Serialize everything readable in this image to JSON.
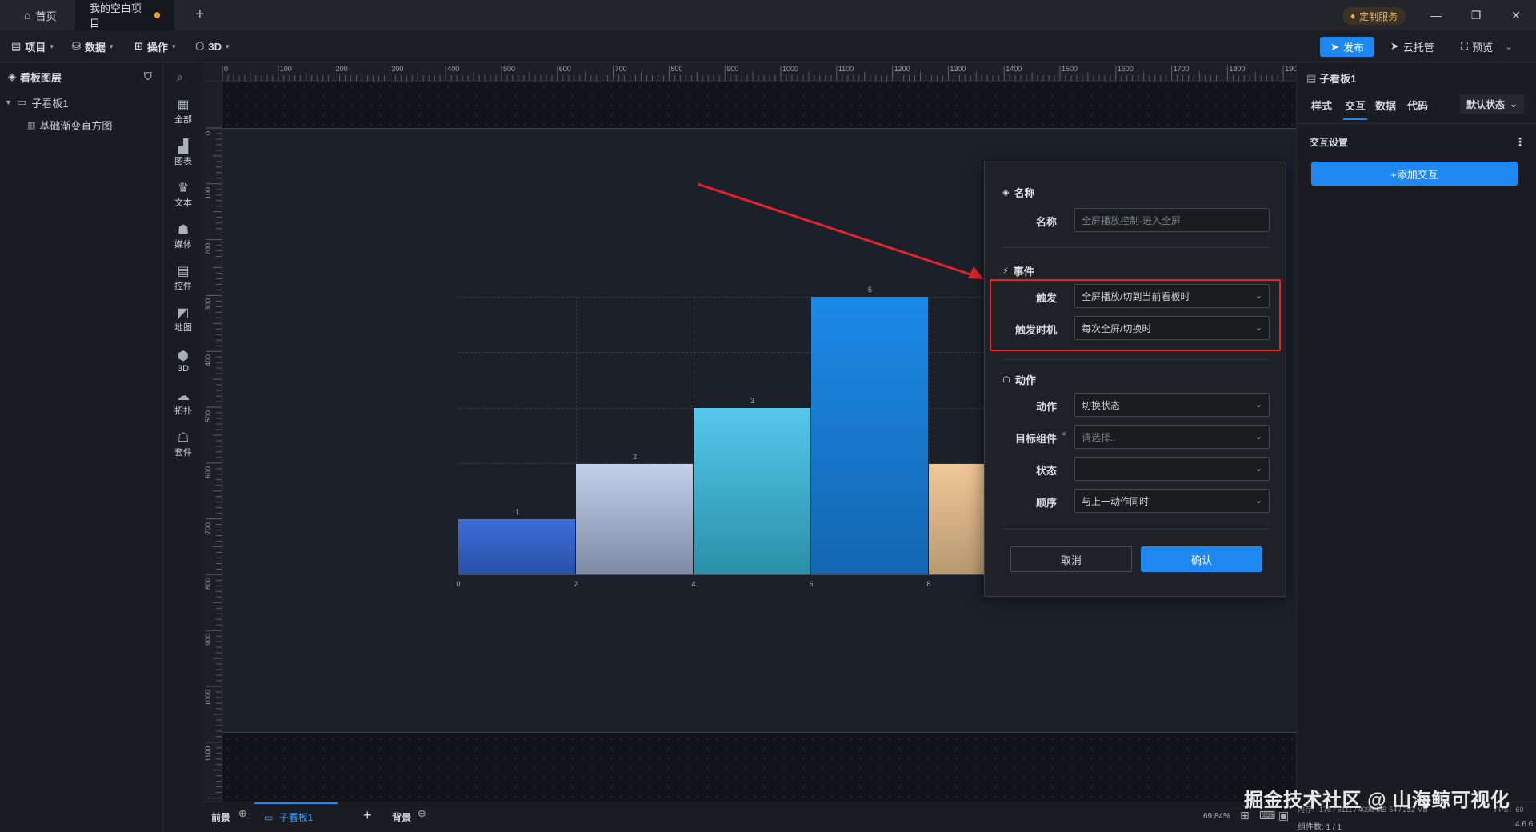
{
  "titlebar": {
    "home_tab": "首页",
    "project_tab": "我的空白项目",
    "service_badge": "定制服务"
  },
  "menubar": {
    "items": [
      {
        "label": "项目"
      },
      {
        "label": "数据"
      },
      {
        "label": "操作"
      },
      {
        "label": "3D"
      }
    ],
    "publish_label": "发布",
    "cloud_label": "云托管",
    "preview_label": "预览"
  },
  "layers": {
    "title": "看板图层",
    "board_name": "子看板1",
    "child_name": "基础渐变直方图"
  },
  "tools": [
    {
      "label": "全部",
      "icon": "grid-icon"
    },
    {
      "label": "图表",
      "icon": "bar-chart-icon"
    },
    {
      "label": "文本",
      "icon": "text-icon"
    },
    {
      "label": "媒体",
      "icon": "media-icon"
    },
    {
      "label": "控件",
      "icon": "control-icon"
    },
    {
      "label": "地图",
      "icon": "map-icon"
    },
    {
      "label": "3D",
      "icon": "cube-icon"
    },
    {
      "label": "拓扑",
      "icon": "topology-icon"
    },
    {
      "label": "套件",
      "icon": "kit-icon"
    }
  ],
  "ruler": {
    "top": [
      "0",
      "100",
      "200",
      "300",
      "400",
      "500",
      "600",
      "700",
      "800",
      "900",
      "1000",
      "1100",
      "1200",
      "1300",
      "1400",
      "1500",
      "1600",
      "1700",
      "1800",
      "1900"
    ],
    "left": [
      "0",
      "100",
      "200",
      "300",
      "400",
      "500",
      "600",
      "700",
      "800",
      "900",
      "1000",
      "1100"
    ]
  },
  "chart_data": {
    "type": "bar",
    "categories": [
      "0-2",
      "2-4",
      "4-6",
      "6-8",
      "8-10"
    ],
    "values": [
      1,
      2,
      3,
      5,
      2
    ],
    "data_labels": [
      "1",
      "2",
      "3",
      "5"
    ],
    "x_ticks": [
      "0",
      "2",
      "4",
      "6",
      "8"
    ],
    "ylim": [
      0,
      5
    ],
    "grid": true,
    "colors": [
      [
        "#3a6fd8",
        "#2a4fa8"
      ],
      [
        "#c4d0ea",
        "#7e8aa4"
      ],
      [
        "#54c8ec",
        "#2a8fa8"
      ],
      [
        "#1a8ae8",
        "#1466b0"
      ],
      [
        "#f0c898",
        "#b89870"
      ]
    ]
  },
  "dialog": {
    "name_section": "名称",
    "name_label": "名称",
    "name_placeholder": "全屏播放控制-进入全屏",
    "event_section": "事件",
    "trigger_label": "触发",
    "trigger_value": "全屏播放/切到当前看板时",
    "timing_label": "触发时机",
    "timing_value": "每次全屏/切换时",
    "action_section": "动作",
    "action_label": "动作",
    "action_value": "切换状态",
    "target_label": "目标组件",
    "target_placeholder": "请选择..",
    "state_label": "状态",
    "state_value": "",
    "order_label": "顺序",
    "order_value": "与上一动作同时",
    "cancel_label": "取消",
    "confirm_label": "确认",
    "highlight_color": "#e0242c"
  },
  "rpanel": {
    "title": "子看板1",
    "tabs": [
      {
        "label": "样式"
      },
      {
        "label": "交互"
      },
      {
        "label": "数据"
      },
      {
        "label": "代码"
      }
    ],
    "state_select": "默认状态",
    "section_title": "交互设置",
    "add_label": "+添加交互"
  },
  "bottombar": {
    "foreground": "前景",
    "board": "子看板1",
    "background": "背景",
    "zoom": "69.84%",
    "memory": "内存：178 / 5111 / 4096 MB  54 / 232 MB",
    "fps": "FPS：60",
    "component_count": "组件数: 1 / 1",
    "version": "4.6.6"
  },
  "watermark": "掘金技术社区 @ 山海鲸可视化"
}
